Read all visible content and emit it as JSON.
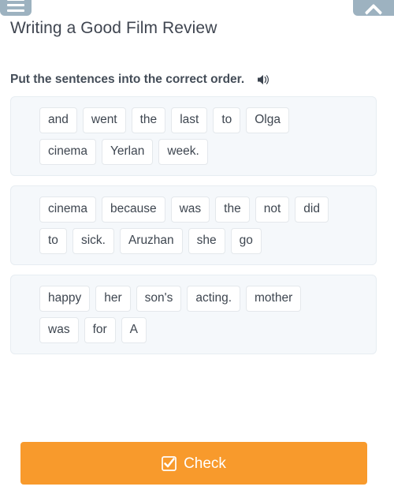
{
  "topbar": {
    "menu_icon": "hamburger-menu-icon",
    "collapse_icon": "chevron-up-icon"
  },
  "header": {
    "title": "Writing a Good Film Review"
  },
  "instruction": {
    "text": "Put the sentences into the correct order.",
    "audio_icon": "speaker-icon"
  },
  "exercise": {
    "cards": [
      {
        "rows": [
          [
            "and",
            "went",
            "the",
            "last",
            "to",
            "Olga"
          ],
          [
            "cinema",
            "Yerlan",
            "week."
          ]
        ]
      },
      {
        "rows": [
          [
            "cinema",
            "because",
            "was",
            "the",
            "not",
            "did"
          ],
          [
            "to",
            "sick.",
            "Aruzhan",
            "she",
            "go"
          ]
        ]
      },
      {
        "rows": [
          [
            "happy",
            "her",
            "son's",
            "acting.",
            "mother"
          ],
          [
            "was",
            "for",
            "A"
          ]
        ]
      }
    ]
  },
  "footer": {
    "check_label": "Check",
    "check_icon": "checked-checkbox-icon",
    "check_color": "#f89a2c"
  },
  "colors": {
    "page_background": "#ffffff",
    "card_background": "#f5f8fb",
    "card_border": "#e7edf2",
    "chip_background": "#ffffff",
    "chip_border": "#e4e8ec",
    "text": "#3e4650",
    "topbar_icon_background": "#9db2c0",
    "accent": "#f89a2c"
  }
}
